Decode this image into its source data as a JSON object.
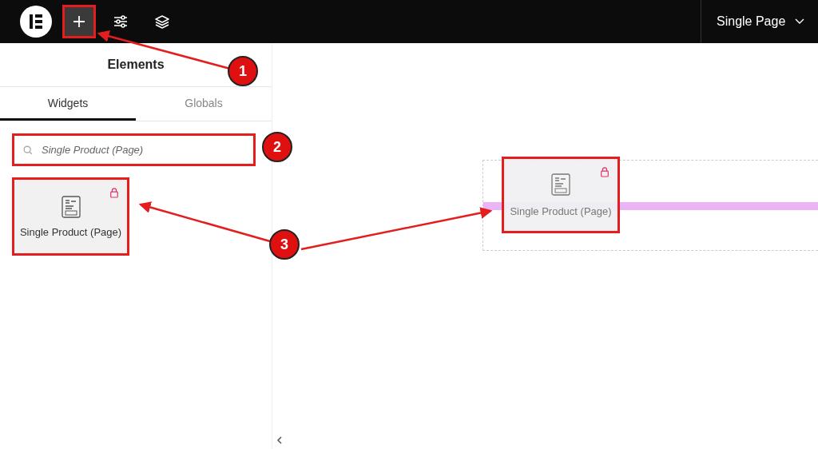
{
  "topbar": {
    "document_title": "Single Page"
  },
  "panel": {
    "title": "Elements",
    "tabs": [
      {
        "label": "Widgets",
        "selected": true
      },
      {
        "label": "Globals",
        "selected": false
      }
    ],
    "search": {
      "value": "Single Product (Page)"
    },
    "widgets": [
      {
        "label": "Single Product (Page)",
        "locked": true
      }
    ]
  },
  "canvas": {
    "dragged_widget": {
      "label": "Single Product (Page)",
      "locked": true
    }
  },
  "annotations": [
    {
      "label": "1"
    },
    {
      "label": "2"
    },
    {
      "label": "3"
    }
  ]
}
